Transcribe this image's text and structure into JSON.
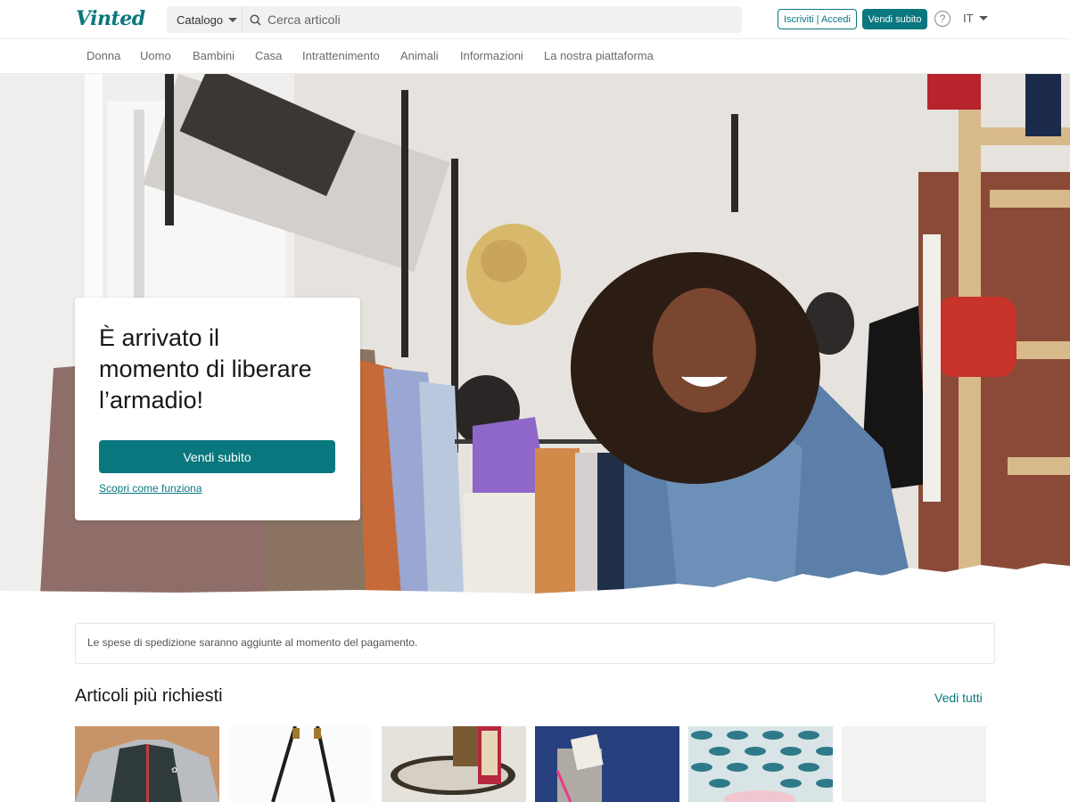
{
  "header": {
    "logo": "Vinted",
    "catalog_label": "Catalogo",
    "search_placeholder": "Cerca articoli",
    "login_label": "Iscriviti | Accedi",
    "sell_label": "Vendi subito",
    "help_icon": "question-circle-icon",
    "lang": "IT"
  },
  "categories": [
    "Donna",
    "Uomo",
    "Bambini",
    "Casa",
    "Intrattenimento",
    "Animali",
    "Informazioni",
    "La nostra piattaforma"
  ],
  "hero": {
    "title_line1": "È arrivato il",
    "title_line2": "momento di liberare",
    "title_line3": "l’armadio!",
    "cta_label": "Vendi subito",
    "link_label": "Scopri come funziona"
  },
  "notice": "Le spese di spedizione saranno aggiunte al momento del pagamento.",
  "popular": {
    "title": "Articoli più richiesti",
    "see_all": "Vedi tutti"
  },
  "colors": {
    "brand": "#09777e"
  }
}
